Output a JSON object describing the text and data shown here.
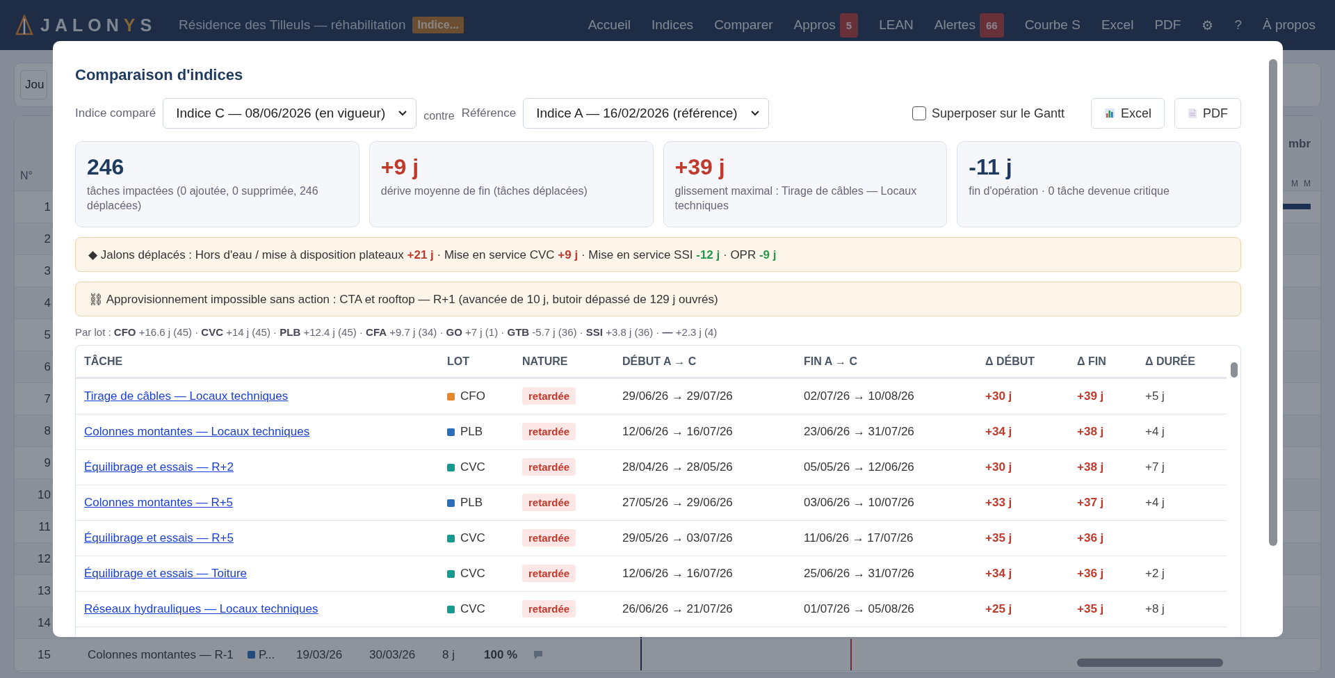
{
  "app": {
    "logo": [
      {
        "text": "JALON",
        "accent": false
      },
      {
        "text": "Y",
        "accent": true
      },
      {
        "text": "S",
        "accent": false
      }
    ],
    "project": "Résidence des Tilleuls — réhabilitation",
    "project_badge": "Indice...",
    "nav": [
      {
        "label": "Accueil"
      },
      {
        "label": "Indices"
      },
      {
        "label": "Comparer"
      },
      {
        "label": "Appros",
        "count": "5"
      },
      {
        "label": "LEAN"
      },
      {
        "label": "Alertes",
        "count": "66"
      },
      {
        "label": "Courbe S"
      },
      {
        "label": "Excel"
      },
      {
        "label": "PDF"
      },
      {
        "label": "⚙"
      },
      {
        "label": "?"
      },
      {
        "label": "À propos"
      }
    ]
  },
  "background": {
    "toolbar_button": "Jou",
    "number_header": "N°",
    "row_numbers": [
      "1",
      "2",
      "3",
      "4",
      "5",
      "6",
      "7",
      "8",
      "9",
      "10",
      "11",
      "12",
      "13",
      "14",
      "15"
    ],
    "last_row": {
      "task": "Colonnes montantes — R-1",
      "lot": "P...",
      "start": "19/03/26",
      "end": "30/03/26",
      "duration": "8 j",
      "progress": "100 %"
    },
    "gantt_month": "mbr",
    "gantt_days": [
      "M",
      "M"
    ]
  },
  "modal": {
    "title": "Comparaison d'indices",
    "compared_label": "Indice comparé",
    "compared_value": "Indice C — 08/06/2026 (en vigueur)",
    "versus": "contre",
    "reference_label": "Référence",
    "reference_value": "Indice A — 16/02/2026 (référence)",
    "overlay_checkbox": {
      "label": "Superposer sur le Gantt",
      "checked": false
    },
    "buttons": [
      {
        "kind": "excel",
        "label": "Excel"
      },
      {
        "kind": "pdf",
        "label": "PDF"
      }
    ],
    "cards": [
      {
        "value": "246",
        "kind": "neutral",
        "caption": "tâches impactées (0 ajoutée, 0 supprimée, 246 déplacées)"
      },
      {
        "value": "+9 j",
        "kind": "late",
        "caption": "dérive moyenne de fin (tâches déplacées)"
      },
      {
        "value": "+39 j",
        "kind": "late",
        "caption": "glissement maximal : Tirage de câbles — Locaux techniques"
      },
      {
        "value": "-11 j",
        "kind": "neutral",
        "caption": "fin d'opération · 0 tâche devenue critique"
      }
    ],
    "milestones": [
      {
        "text": "◆ Jalons déplacés : Hors d'eau / mise à disposition plateaux ",
        "kind": "plain"
      },
      {
        "text": "+21 j",
        "kind": "late"
      },
      {
        "text": " · Mise en service CVC ",
        "kind": "plain"
      },
      {
        "text": "+9 j",
        "kind": "late"
      },
      {
        "text": " · Mise en service SSI ",
        "kind": "plain"
      },
      {
        "text": "-12 j",
        "kind": "early"
      },
      {
        "text": " · OPR ",
        "kind": "plain"
      },
      {
        "text": "-9 j",
        "kind": "early"
      }
    ],
    "supply_alert": "⛓ Approvisionnement impossible sans action : CTA et rooftop — R+1 (avancée de 10 j, butoir dépassé de 129 j ouvrés)",
    "by_lot": "Par lot : **CFO** +16.6 j (45) · **CVC** +14 j (45) · **PLB** +12.4 j (45) · **CFA** +9.7 j (34) · **GO** +7 j (1) · **GTB** -5.7 j (36) · **SSI** +3.8 j (36) · **—** +2.3 j (4)",
    "table": {
      "columns": [
        "TÂCHE",
        "LOT",
        "NATURE",
        "DÉBUT A → C",
        "FIN A → C",
        "Δ DÉBUT",
        "Δ FIN",
        "Δ DURÉE"
      ],
      "rows": [
        {
          "task": "Tirage de câbles — Locaux techniques",
          "lot": "CFO",
          "color": "#e8862a",
          "nature": "retardée",
          "start": "29/06/26 → 29/07/26",
          "end": "02/07/26 → 10/08/26",
          "d_start": "+30 j",
          "d_end": "+39 j",
          "d_duration": "+5 j"
        },
        {
          "task": "Colonnes montantes — Locaux techniques",
          "lot": "PLB",
          "color": "#2a6ebb",
          "nature": "retardée",
          "start": "12/06/26 → 16/07/26",
          "end": "23/06/26 → 31/07/26",
          "d_start": "+34 j",
          "d_end": "+38 j",
          "d_duration": "+4 j"
        },
        {
          "task": "Équilibrage et essais — R+2",
          "lot": "CVC",
          "color": "#149a8f",
          "nature": "retardée",
          "start": "28/04/26 → 28/05/26",
          "end": "05/05/26 → 12/06/26",
          "d_start": "+30 j",
          "d_end": "+38 j",
          "d_duration": "+7 j"
        },
        {
          "task": "Colonnes montantes — R+5",
          "lot": "PLB",
          "color": "#2a6ebb",
          "nature": "retardée",
          "start": "27/05/26 → 29/06/26",
          "end": "03/06/26 → 10/07/26",
          "d_start": "+33 j",
          "d_end": "+37 j",
          "d_duration": "+4 j"
        },
        {
          "task": "Équilibrage et essais — R+5",
          "lot": "CVC",
          "color": "#149a8f",
          "nature": "retardée",
          "start": "29/05/26 → 03/07/26",
          "end": "11/06/26 → 17/07/26",
          "d_start": "+35 j",
          "d_end": "+36 j"
        },
        {
          "task": "Équilibrage et essais — Toiture",
          "lot": "CVC",
          "color": "#149a8f",
          "nature": "retardée",
          "start": "12/06/26 → 16/07/26",
          "end": "25/06/26 → 31/07/26",
          "d_start": "+34 j",
          "d_end": "+36 j",
          "d_duration": "+2 j"
        },
        {
          "task": "Réseaux hydrauliques — Locaux techniques",
          "lot": "CVC",
          "color": "#149a8f",
          "nature": "retardée",
          "start": "26/06/26 → 21/07/26",
          "end": "01/07/26 → 05/08/26",
          "d_start": "+25 j",
          "d_end": "+35 j",
          "d_duration": "+8 j"
        }
      ]
    }
  }
}
